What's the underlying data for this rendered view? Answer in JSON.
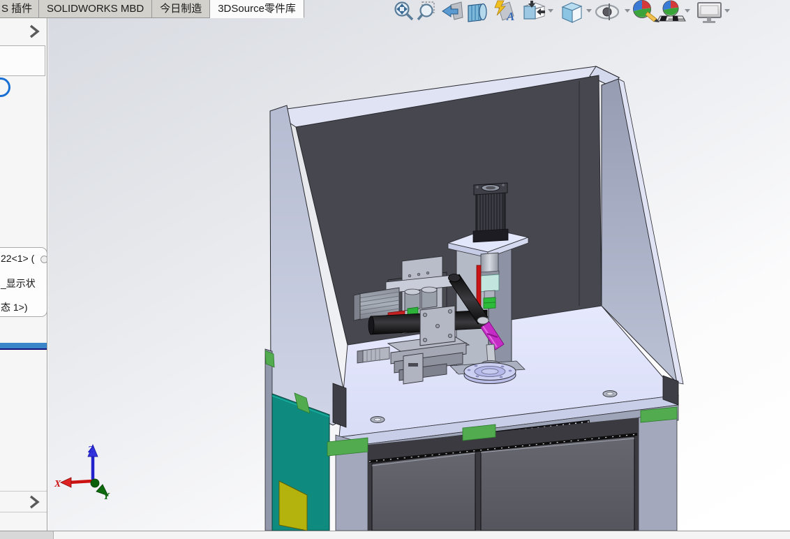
{
  "ribbon_tabs": [
    {
      "label": "S 插件",
      "state": "inactive",
      "partial": true
    },
    {
      "label": "SOLIDWORKS MBD",
      "state": "inactive"
    },
    {
      "label": "今日制造",
      "state": "inactive"
    },
    {
      "label": "3DSource零件库",
      "state": "active"
    }
  ],
  "heads_up_toolbar": {
    "icons": [
      {
        "name": "zoom-to-fit-icon",
        "has_dropdown": false
      },
      {
        "name": "zoom-to-area-icon",
        "has_dropdown": false
      },
      {
        "name": "previous-view-icon",
        "has_dropdown": false
      },
      {
        "name": "section-view-icon",
        "has_dropdown": false
      },
      {
        "name": "dynamic-annotation-views-icon",
        "has_dropdown": false
      },
      {
        "name": "view-orientation-icon",
        "has_dropdown": true
      },
      {
        "name": "display-style-icon",
        "has_dropdown": true
      },
      {
        "name": "hide-show-items-icon",
        "has_dropdown": true
      },
      {
        "name": "edit-appearance-icon",
        "has_dropdown": false
      },
      {
        "name": "apply-scene-icon",
        "has_dropdown": true
      },
      {
        "name": "view-settings-icon",
        "has_dropdown": true
      }
    ]
  },
  "feature_panel": {
    "tree_fragments": {
      "line1": "22<1> (",
      "line2": "_显示状",
      "line3": "态 1>)"
    },
    "selection_bar_color": "#3b86c9"
  },
  "viewport": {
    "axis_triad": {
      "x_label": "X",
      "y_label": "Y",
      "z_label": "Z",
      "x_color": "#cc1111",
      "y_color": "#0d6b0d",
      "z_color": "#2222cc"
    },
    "model_colors": {
      "enclosure_back_panel": "#47474f",
      "frame_gray": "#a3a8bc",
      "rim_lavender": "#dfe3f4",
      "tabletop": "#e2e6fc",
      "door_gray": "#5d5d65",
      "side_panel_teal": "#0e8a7f",
      "window_yellow": "#b4b30e",
      "accent_green": "#52ab4e",
      "actuator_magenta": "#c52cc5",
      "collar_green": "#2dbb3a",
      "sensor_red": "#c81414",
      "cylinder_cyan": "#c2e5de",
      "black_extrusion": "#2a2a31"
    }
  }
}
